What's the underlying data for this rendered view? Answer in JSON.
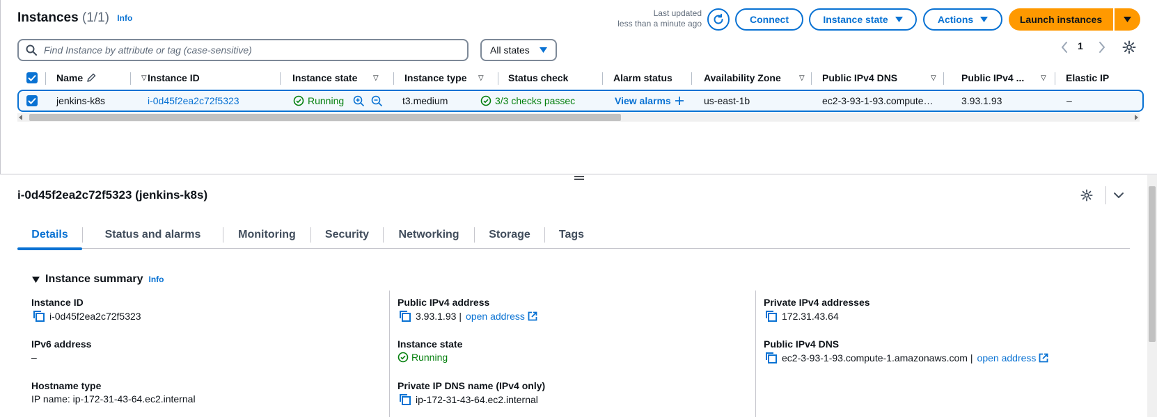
{
  "header": {
    "title": "Instances",
    "count": "(1/1)",
    "info_label": "Info",
    "last_updated_line1": "Last updated",
    "last_updated_line2": "less than a minute ago",
    "connect_label": "Connect",
    "instance_state_label": "Instance state",
    "actions_label": "Actions",
    "launch_label": "Launch instances"
  },
  "filter": {
    "search_placeholder": "Find Instance by attribute or tag (case-sensitive)",
    "states_label": "All states"
  },
  "pagination": {
    "page": "1"
  },
  "table": {
    "columns": [
      "Name",
      "Instance ID",
      "Instance state",
      "Instance type",
      "Status check",
      "Alarm status",
      "Availability Zone",
      "Public IPv4 DNS",
      "Public IPv4 ...",
      "Elastic IP"
    ],
    "row": {
      "name": "jenkins-k8s",
      "instance_id": "i-0d45f2ea2c72f5323",
      "state": "Running",
      "type": "t3.medium",
      "status_check": "3/3 checks passec",
      "alarm": "View alarms",
      "az": "us-east-1b",
      "public_dns": "ec2-3-93-1-93.compute…",
      "public_ip": "3.93.1.93",
      "elastic_ip": "–"
    }
  },
  "details": {
    "title": "i-0d45f2ea2c72f5323 (jenkins-k8s)",
    "tabs": [
      "Details",
      "Status and alarms",
      "Monitoring",
      "Security",
      "Networking",
      "Storage",
      "Tags"
    ],
    "summary_label": "Instance summary",
    "info_label": "Info",
    "fields": {
      "instance_id_label": "Instance ID",
      "instance_id": "i-0d45f2ea2c72f5323",
      "ipv6_label": "IPv6 address",
      "ipv6": "–",
      "hostname_type_label": "Hostname type",
      "hostname_type": "IP name: ip-172-31-43-64.ec2.internal",
      "public_ipv4_label": "Public IPv4 address",
      "public_ipv4": "3.93.1.93",
      "open_address": "open address",
      "instance_state_label": "Instance state",
      "instance_state": "Running",
      "private_dns_label": "Private IP DNS name (IPv4 only)",
      "private_dns": "ip-172-31-43-64.ec2.internal",
      "private_ipv4_label": "Private IPv4 addresses",
      "private_ipv4": "172.31.43.64",
      "public_dns_label": "Public IPv4 DNS",
      "public_dns": "ec2-3-93-1-93.compute-1.amazonaws.com",
      "open_address2": "open address"
    }
  },
  "colors": {
    "accent": "#0972d3",
    "launch": "#ff9900",
    "success": "#037f0c",
    "row_selected_bg": "#f2f8fd"
  }
}
